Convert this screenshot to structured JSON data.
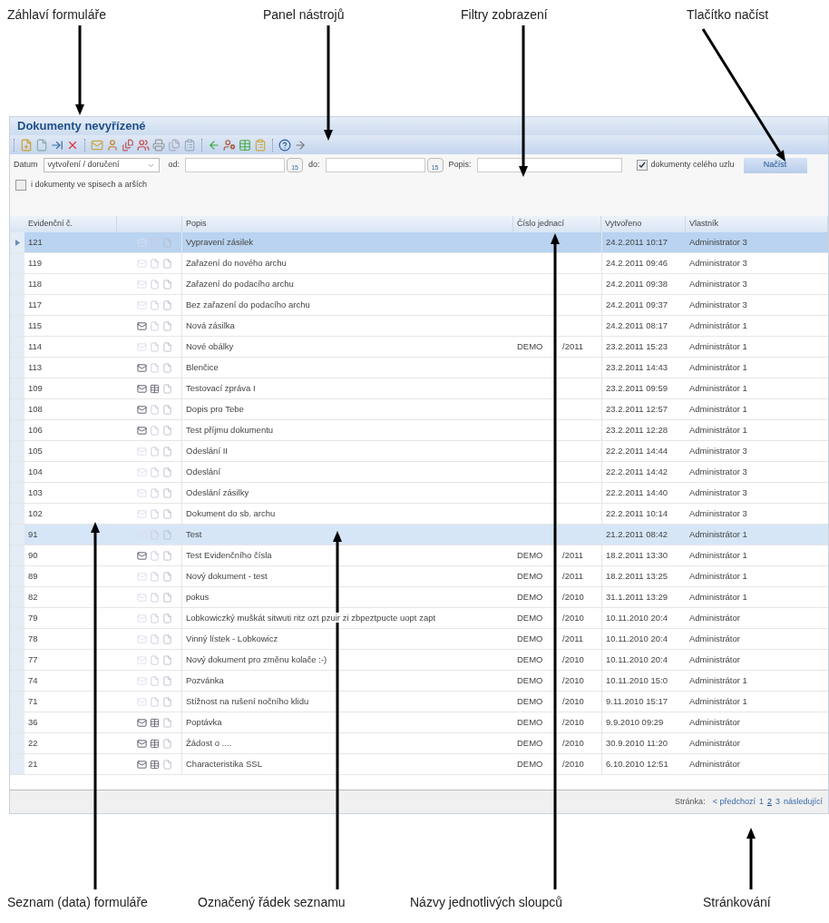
{
  "annotations_top": [
    {
      "text": "Záhlaví formuláře"
    },
    {
      "text": "Panel nástrojů"
    },
    {
      "text": "Filtry zobrazení"
    },
    {
      "text": "Tlačítko načíst"
    }
  ],
  "annotations_bottom": [
    {
      "text": "Seznam (data) formuláře"
    },
    {
      "text": "Označený řádek seznamu"
    },
    {
      "text": "Názvy jednotlivých sloupců"
    },
    {
      "text": "Stránkování"
    }
  ],
  "form": {
    "title": "Dokumenty nevyřízené",
    "filters": {
      "date_label": "Datum",
      "date_type": "vytvoření / doručení",
      "from_label": "od:",
      "to_label": "do:",
      "from_calendar_day": "15",
      "to_calendar_day": "15",
      "description_label": "Popis:",
      "whole_node": {
        "label": "dokumenty celého uzlu",
        "checked": true
      },
      "load_button": "Načíst",
      "include_files": {
        "label": "i dokumenty ve spisech a arších",
        "checked": false
      }
    },
    "table": {
      "columns": [
        "Evidenční č.",
        "Popis",
        "Číslo jednací",
        "Vytvořeno",
        "Vlastník"
      ],
      "rows": [
        {
          "id": "121",
          "envelope": false,
          "table": false,
          "description": "Vypravení zásilek",
          "created": "24.2.2011 10:17",
          "owner": "Administrator 3",
          "selected": true,
          "current": true
        },
        {
          "id": "119",
          "envelope": false,
          "table": false,
          "description": "Zařazení do nového archu",
          "created": "24.2.2011 09:46",
          "owner": "Administrator 3",
          "selected": false,
          "current": false
        },
        {
          "id": "118",
          "envelope": false,
          "table": false,
          "description": "Zařazení do podacího archu",
          "created": "24.2.2011 09:38",
          "owner": "Administrator 3",
          "selected": false,
          "current": false
        },
        {
          "id": "117",
          "envelope": false,
          "table": false,
          "description": "Bez zařazení do podacího archu",
          "created": "24.2.2011 09:37",
          "owner": "Administrator 3",
          "selected": false,
          "current": false
        },
        {
          "id": "115",
          "envelope": true,
          "table": false,
          "description": "Nová zásilka",
          "created": "24.2.2011 08:17",
          "owner": "Administrátor 1",
          "selected": false,
          "current": false
        },
        {
          "id": "114",
          "envelope": false,
          "table": false,
          "description": "Nové obálky",
          "reference": "DEMO",
          "reference_number": "/2011",
          "created": "23.2.2011 15:23",
          "owner": "Administrátor 1",
          "selected": false,
          "current": false
        },
        {
          "id": "113",
          "envelope": true,
          "table": false,
          "description": "Blenčice",
          "created": "23.2.2011 14:43",
          "owner": "Administrátor 1",
          "selected": false,
          "current": false
        },
        {
          "id": "109",
          "envelope": true,
          "table": true,
          "description": "Testovací zpráva I",
          "created": "23.2.2011 09:59",
          "owner": "Administrátor 1",
          "selected": false,
          "current": false
        },
        {
          "id": "108",
          "envelope": true,
          "table": false,
          "description": "Dopis pro Tebe",
          "created": "23.2.2011 12:57",
          "owner": "Administrátor 1",
          "selected": false,
          "current": false
        },
        {
          "id": "106",
          "envelope": true,
          "table": false,
          "description": "Test příjmu dokumentu",
          "created": "23.2.2011 12:28",
          "owner": "Administrátor 1",
          "selected": false,
          "current": false
        },
        {
          "id": "105",
          "envelope": false,
          "table": false,
          "description": "Odeslání II",
          "created": "22.2.2011 14:44",
          "owner": "Administrator 3",
          "selected": false,
          "current": false
        },
        {
          "id": "104",
          "envelope": false,
          "table": false,
          "description": "Odeslání",
          "created": "22.2.2011 14:42",
          "owner": "Administrator 3",
          "selected": false,
          "current": false
        },
        {
          "id": "103",
          "envelope": false,
          "table": false,
          "description": "Odeslání zásilky",
          "created": "22.2.2011 14:40",
          "owner": "Administrator 3",
          "selected": false,
          "current": false
        },
        {
          "id": "102",
          "envelope": false,
          "table": false,
          "description": "Dokument do sb. archu",
          "created": "22.2.2011 10:14",
          "owner": "Administrator 3",
          "selected": false,
          "current": false
        },
        {
          "id": "91",
          "envelope": false,
          "table": false,
          "description": "Test",
          "created": "21.2.2011 08:42",
          "owner": "Administrátor 1",
          "selected": true,
          "current": false
        },
        {
          "id": "90",
          "envelope": true,
          "table": false,
          "description": "Test Evidenčního čísla",
          "reference": "DEMO",
          "reference_number": "/2011",
          "created": "18.2.2011 13:30",
          "owner": "Administrátor 1",
          "selected": false,
          "current": false
        },
        {
          "id": "89",
          "envelope": false,
          "table": false,
          "description": "Nový dokument - test",
          "reference": "DEMO",
          "reference_number": "/2011",
          "created": "18.2.2011 13:25",
          "owner": "Administrátor 1",
          "selected": false,
          "current": false
        },
        {
          "id": "82",
          "envelope": false,
          "table": false,
          "description": "pokus",
          "reference": "DEMO",
          "reference_number": "/2010",
          "created": "31.1.2011 13:29",
          "owner": "Administrátor 1",
          "selected": false,
          "current": false
        },
        {
          "id": "79",
          "envelope": false,
          "table": false,
          "description": "Lobkowiczký muškát sitwuti ritz ozt pzuir zi zbpeztpucte uopt zapt",
          "reference": "DEMO",
          "reference_number": "/2010",
          "created": "10.11.2010 20:4",
          "owner": "Administrátor",
          "selected": false,
          "current": false
        },
        {
          "id": "78",
          "envelope": false,
          "table": false,
          "description": "Vinný lístek - Lobkowicz",
          "reference": "DEMO",
          "reference_number": "/2011",
          "created": "10.11.2010 20:4",
          "owner": "Administrátor",
          "selected": false,
          "current": false
        },
        {
          "id": "77",
          "envelope": false,
          "table": false,
          "description": "Nový dokument pro změnu kolače :-)",
          "reference": "DEMO",
          "reference_number": "/2010",
          "created": "10.11.2010 20:4",
          "owner": "Administrátor",
          "selected": false,
          "current": false
        },
        {
          "id": "74",
          "envelope": false,
          "table": false,
          "description": "Pozvánka",
          "reference": "DEMO",
          "reference_number": "/2010",
          "created": "10.11.2010 15:0",
          "owner": "Administrátor 1",
          "selected": false,
          "current": false
        },
        {
          "id": "71",
          "envelope": false,
          "table": false,
          "description": "Stížnost na rušení nočního klidu",
          "reference": "DEMO",
          "reference_number": "/2010",
          "created": "9.11.2010 15:17",
          "owner": "Administrátor 1",
          "selected": false,
          "current": false
        },
        {
          "id": "36",
          "envelope": true,
          "table": true,
          "description": "Poptávka",
          "reference": "DEMO",
          "reference_number": "/2010",
          "created": "9.9.2010 09:29",
          "owner": "Administrátor",
          "selected": false,
          "current": false
        },
        {
          "id": "22",
          "envelope": true,
          "table": true,
          "description": "Žádost o ....",
          "reference": "DEMO",
          "reference_number": "/2010",
          "created": "30.9.2010 11:20",
          "owner": "Administrátor",
          "selected": false,
          "current": false
        },
        {
          "id": "21",
          "envelope": true,
          "table": true,
          "description": "Characteristika SSL",
          "reference": "DEMO",
          "reference_number": "/2010",
          "created": "6.10.2010 12:51",
          "owner": "Administrátor",
          "selected": false,
          "current": false
        }
      ]
    },
    "pager": {
      "label": "Stránka:",
      "previous": "< předchozí",
      "pages": [
        {
          "label": "1",
          "selected": false
        },
        {
          "label": "2",
          "selected": true
        },
        {
          "label": "3",
          "selected": false
        }
      ],
      "next": "následující"
    }
  }
}
